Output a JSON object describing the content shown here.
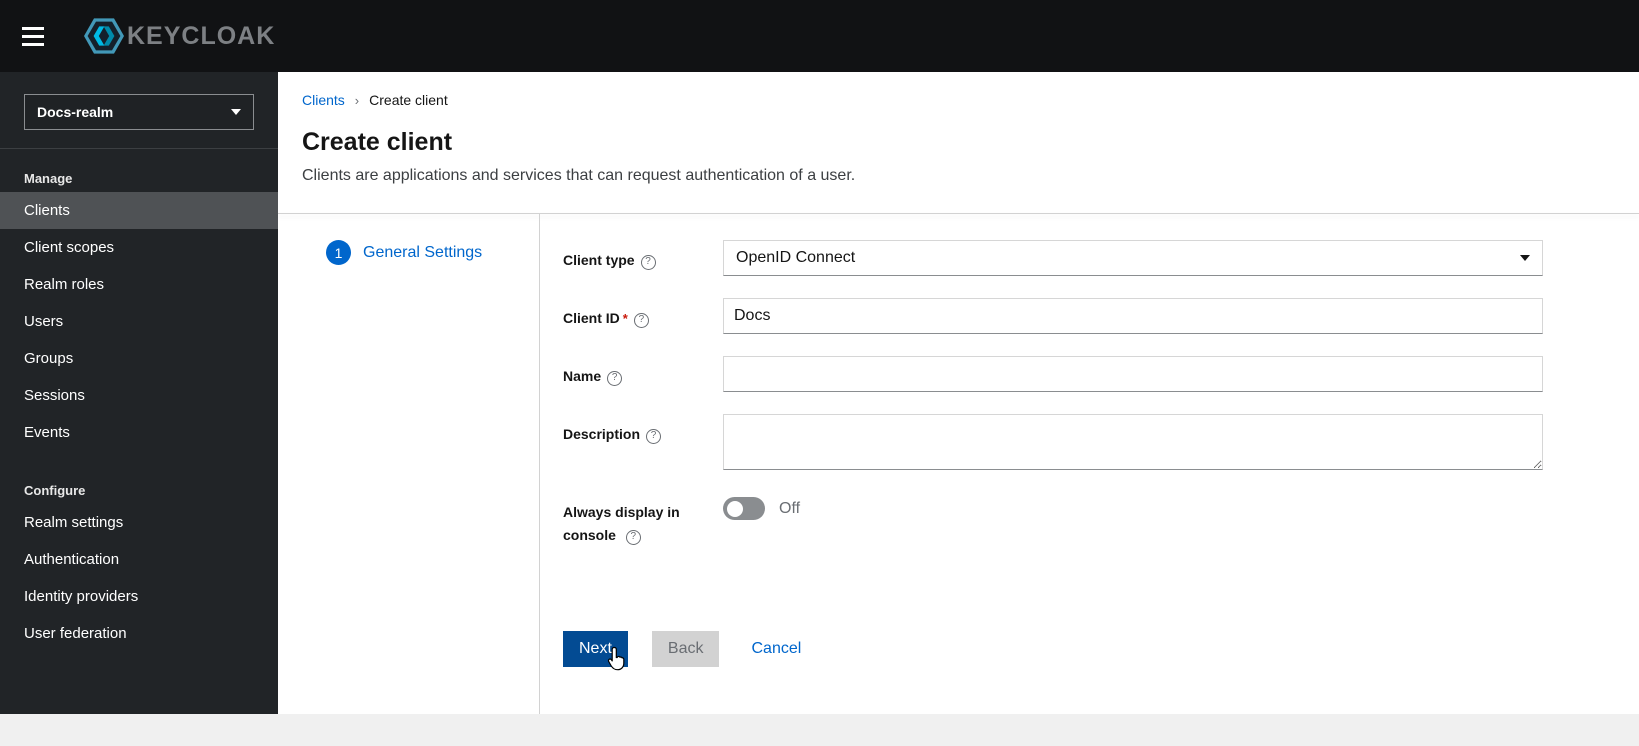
{
  "header": {
    "brand": "KEYCLOAK"
  },
  "sidebar": {
    "realm_selector": {
      "value": "Docs-realm"
    },
    "sections": [
      {
        "label": "Manage",
        "items": [
          {
            "label": "Clients",
            "active": true
          },
          {
            "label": "Client scopes",
            "active": false
          },
          {
            "label": "Realm roles",
            "active": false
          },
          {
            "label": "Users",
            "active": false
          },
          {
            "label": "Groups",
            "active": false
          },
          {
            "label": "Sessions",
            "active": false
          },
          {
            "label": "Events",
            "active": false
          }
        ]
      },
      {
        "label": "Configure",
        "items": [
          {
            "label": "Realm settings",
            "active": false
          },
          {
            "label": "Authentication",
            "active": false
          },
          {
            "label": "Identity providers",
            "active": false
          },
          {
            "label": "User federation",
            "active": false
          }
        ]
      }
    ]
  },
  "breadcrumb": {
    "items": [
      {
        "label": "Clients"
      },
      {
        "label": "Create client"
      }
    ],
    "separator": "›"
  },
  "page": {
    "title": "Create client",
    "subtitle": "Clients are applications and services that can request authentication of a user."
  },
  "wizard": {
    "steps": [
      {
        "number": "1",
        "label": "General Settings",
        "active": true
      }
    ]
  },
  "form": {
    "client_type": {
      "label": "Client type",
      "value": "OpenID Connect"
    },
    "client_id": {
      "label": "Client ID",
      "required_marker": "*",
      "value": "Docs"
    },
    "name": {
      "label": "Name",
      "value": ""
    },
    "description": {
      "label": "Description",
      "value": ""
    },
    "always_display": {
      "label": "Always display in console",
      "state_label": "Off"
    }
  },
  "actions": {
    "next": "Next",
    "back": "Back",
    "cancel": "Cancel"
  },
  "icons": {
    "help": "?"
  },
  "colors": {
    "header_bg": "#111214",
    "sidebar_bg": "#212427",
    "active_nav_bg": "#4f5255",
    "link_blue": "#0066cc",
    "primary_button": "#034b93",
    "required_red": "#c9190b",
    "toggle_off_gray": "#8a8d90"
  }
}
